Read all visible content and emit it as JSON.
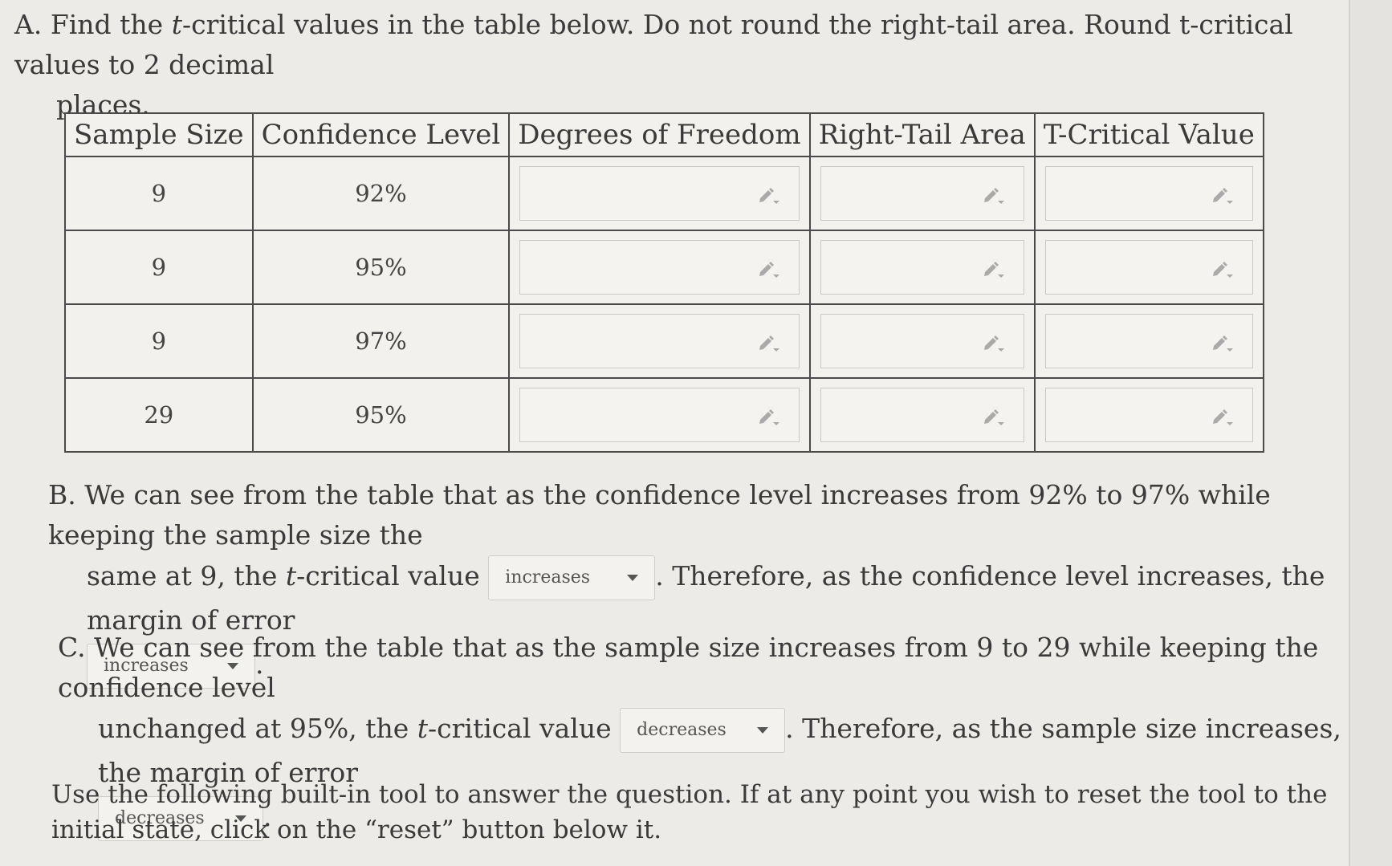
{
  "part_a": {
    "letter": "A.",
    "text_1": "Find the",
    "t": "t",
    "text_2": "-critical values in the table below. Do not round the right-tail area. Round t-critical values to 2 decimal",
    "text_3": "places."
  },
  "table": {
    "headers": [
      "Sample Size",
      "Confidence Level",
      "Degrees of Freedom",
      "Right-Tail Area",
      "T-Critical Value"
    ],
    "rows": [
      {
        "sample_size": "9",
        "confidence": "92%"
      },
      {
        "sample_size": "9",
        "confidence": "95%"
      },
      {
        "sample_size": "9",
        "confidence": "97%"
      },
      {
        "sample_size": "29",
        "confidence": "95%"
      }
    ],
    "edit_icon": "pencil-dropdown-icon"
  },
  "part_b": {
    "letter": "B.",
    "text_1": "We can see from the table that as the confidence level increases from 92% to 97% while keeping the sample size the",
    "text_2a": "same at 9, the",
    "t": "t",
    "text_2b": "-critical value",
    "dropdown_1": "increases",
    "text_3": ". Therefore, as the confidence level increases, the margin of error",
    "dropdown_2": "increases",
    "period": "."
  },
  "part_c": {
    "letter": "C.",
    "text_1": "We can see from the table that as the sample size increases from 9 to 29 while keeping the confidence level",
    "text_2a": "unchanged at 95%, the",
    "t": "t",
    "text_2b": "-critical value",
    "dropdown_1": "decreases",
    "text_3": ". Therefore, as the sample size increases, the margin of error",
    "dropdown_2": "decreases",
    "period": "."
  },
  "part_d": {
    "text": "Use the following built-in tool to answer the question. If at any point you wish to reset the tool to the initial state, click on the “reset” button below it."
  }
}
